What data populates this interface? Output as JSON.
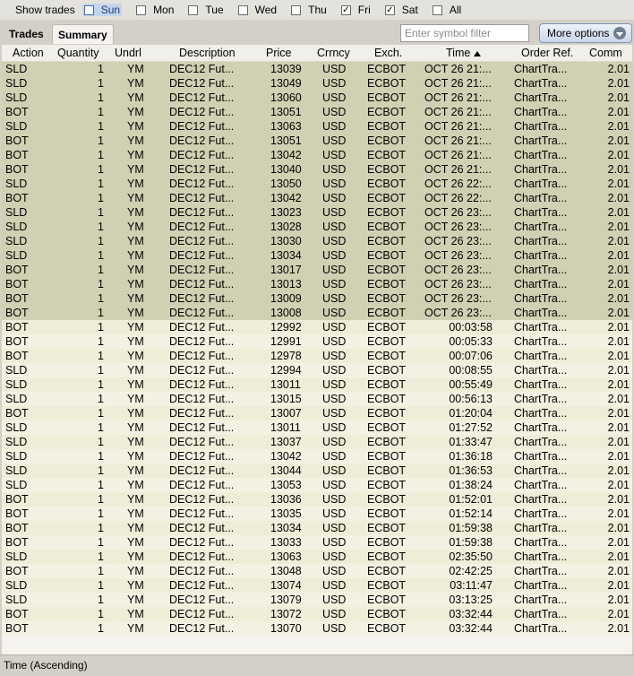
{
  "topbar": {
    "label": "Show trades",
    "days": [
      {
        "label": "Sun",
        "checked": false,
        "selected": true
      },
      {
        "label": "Mon",
        "checked": false
      },
      {
        "label": "Tue",
        "checked": false
      },
      {
        "label": "Wed",
        "checked": false
      },
      {
        "label": "Thu",
        "checked": false
      },
      {
        "label": "Fri",
        "checked": true
      },
      {
        "label": "Sat",
        "checked": true
      },
      {
        "label": "All",
        "checked": false
      }
    ]
  },
  "tabs": {
    "trades": "Trades",
    "summary": "Summary"
  },
  "filter": {
    "placeholder": "Enter symbol filter",
    "value": ""
  },
  "more_options": {
    "label": "More options",
    "icon": "chevron-down-icon"
  },
  "columns": [
    "Action",
    "Quantity",
    "Undrlyng",
    "Description",
    "Price",
    "Crrncy",
    "Exch.",
    "Time",
    "Order Ref.",
    "Comm"
  ],
  "sort": {
    "column": "Time",
    "direction": "ascending"
  },
  "rows": [
    [
      "SLD",
      "1",
      "YM",
      "DEC12 Fut...",
      "13039",
      "USD",
      "ECBOT",
      "OCT 26 21:...",
      "ChartTra...",
      "2.01"
    ],
    [
      "SLD",
      "1",
      "YM",
      "DEC12 Fut...",
      "13049",
      "USD",
      "ECBOT",
      "OCT 26 21:...",
      "ChartTra...",
      "2.01"
    ],
    [
      "SLD",
      "1",
      "YM",
      "DEC12 Fut...",
      "13060",
      "USD",
      "ECBOT",
      "OCT 26 21:...",
      "ChartTra...",
      "2.01"
    ],
    [
      "BOT",
      "1",
      "YM",
      "DEC12 Fut...",
      "13051",
      "USD",
      "ECBOT",
      "OCT 26 21:...",
      "ChartTra...",
      "2.01"
    ],
    [
      "SLD",
      "1",
      "YM",
      "DEC12 Fut...",
      "13063",
      "USD",
      "ECBOT",
      "OCT 26 21:...",
      "ChartTra...",
      "2.01"
    ],
    [
      "BOT",
      "1",
      "YM",
      "DEC12 Fut...",
      "13051",
      "USD",
      "ECBOT",
      "OCT 26 21:...",
      "ChartTra...",
      "2.01"
    ],
    [
      "BOT",
      "1",
      "YM",
      "DEC12 Fut...",
      "13042",
      "USD",
      "ECBOT",
      "OCT 26 21:...",
      "ChartTra...",
      "2.01"
    ],
    [
      "BOT",
      "1",
      "YM",
      "DEC12 Fut...",
      "13040",
      "USD",
      "ECBOT",
      "OCT 26 21:...",
      "ChartTra...",
      "2.01"
    ],
    [
      "SLD",
      "1",
      "YM",
      "DEC12 Fut...",
      "13050",
      "USD",
      "ECBOT",
      "OCT 26 22:...",
      "ChartTra...",
      "2.01"
    ],
    [
      "BOT",
      "1",
      "YM",
      "DEC12 Fut...",
      "13042",
      "USD",
      "ECBOT",
      "OCT 26 22:...",
      "ChartTra...",
      "2.01"
    ],
    [
      "SLD",
      "1",
      "YM",
      "DEC12 Fut...",
      "13023",
      "USD",
      "ECBOT",
      "OCT 26 23:...",
      "ChartTra...",
      "2.01"
    ],
    [
      "SLD",
      "1",
      "YM",
      "DEC12 Fut...",
      "13028",
      "USD",
      "ECBOT",
      "OCT 26 23:...",
      "ChartTra...",
      "2.01"
    ],
    [
      "SLD",
      "1",
      "YM",
      "DEC12 Fut...",
      "13030",
      "USD",
      "ECBOT",
      "OCT 26 23:...",
      "ChartTra...",
      "2.01"
    ],
    [
      "SLD",
      "1",
      "YM",
      "DEC12 Fut...",
      "13034",
      "USD",
      "ECBOT",
      "OCT 26 23:...",
      "ChartTra...",
      "2.01"
    ],
    [
      "BOT",
      "1",
      "YM",
      "DEC12 Fut...",
      "13017",
      "USD",
      "ECBOT",
      "OCT 26 23:...",
      "ChartTra...",
      "2.01"
    ],
    [
      "BOT",
      "1",
      "YM",
      "DEC12 Fut...",
      "13013",
      "USD",
      "ECBOT",
      "OCT 26 23:...",
      "ChartTra...",
      "2.01"
    ],
    [
      "BOT",
      "1",
      "YM",
      "DEC12 Fut...",
      "13009",
      "USD",
      "ECBOT",
      "OCT 26 23:...",
      "ChartTra...",
      "2.01"
    ],
    [
      "BOT",
      "1",
      "YM",
      "DEC12 Fut...",
      "13008",
      "USD",
      "ECBOT",
      "OCT 26 23:...",
      "ChartTra...",
      "2.01"
    ],
    [
      "BOT",
      "1",
      "YM",
      "DEC12 Fut...",
      "12992",
      "USD",
      "ECBOT",
      "00:03:58",
      "ChartTra...",
      "2.01"
    ],
    [
      "BOT",
      "1",
      "YM",
      "DEC12 Fut...",
      "12991",
      "USD",
      "ECBOT",
      "00:05:33",
      "ChartTra...",
      "2.01"
    ],
    [
      "BOT",
      "1",
      "YM",
      "DEC12 Fut...",
      "12978",
      "USD",
      "ECBOT",
      "00:07:06",
      "ChartTra...",
      "2.01"
    ],
    [
      "SLD",
      "1",
      "YM",
      "DEC12 Fut...",
      "12994",
      "USD",
      "ECBOT",
      "00:08:55",
      "ChartTra...",
      "2.01"
    ],
    [
      "SLD",
      "1",
      "YM",
      "DEC12 Fut...",
      "13011",
      "USD",
      "ECBOT",
      "00:55:49",
      "ChartTra...",
      "2.01"
    ],
    [
      "SLD",
      "1",
      "YM",
      "DEC12 Fut...",
      "13015",
      "USD",
      "ECBOT",
      "00:56:13",
      "ChartTra...",
      "2.01"
    ],
    [
      "BOT",
      "1",
      "YM",
      "DEC12 Fut...",
      "13007",
      "USD",
      "ECBOT",
      "01:20:04",
      "ChartTra...",
      "2.01"
    ],
    [
      "SLD",
      "1",
      "YM",
      "DEC12 Fut...",
      "13011",
      "USD",
      "ECBOT",
      "01:27:52",
      "ChartTra...",
      "2.01"
    ],
    [
      "SLD",
      "1",
      "YM",
      "DEC12 Fut...",
      "13037",
      "USD",
      "ECBOT",
      "01:33:47",
      "ChartTra...",
      "2.01"
    ],
    [
      "SLD",
      "1",
      "YM",
      "DEC12 Fut...",
      "13042",
      "USD",
      "ECBOT",
      "01:36:18",
      "ChartTra...",
      "2.01"
    ],
    [
      "SLD",
      "1",
      "YM",
      "DEC12 Fut...",
      "13044",
      "USD",
      "ECBOT",
      "01:36:53",
      "ChartTra...",
      "2.01"
    ],
    [
      "SLD",
      "1",
      "YM",
      "DEC12 Fut...",
      "13053",
      "USD",
      "ECBOT",
      "01:38:24",
      "ChartTra...",
      "2.01"
    ],
    [
      "BOT",
      "1",
      "YM",
      "DEC12 Fut...",
      "13036",
      "USD",
      "ECBOT",
      "01:52:01",
      "ChartTra...",
      "2.01"
    ],
    [
      "BOT",
      "1",
      "YM",
      "DEC12 Fut...",
      "13035",
      "USD",
      "ECBOT",
      "01:52:14",
      "ChartTra...",
      "2.01"
    ],
    [
      "BOT",
      "1",
      "YM",
      "DEC12 Fut...",
      "13034",
      "USD",
      "ECBOT",
      "01:59:38",
      "ChartTra...",
      "2.01"
    ],
    [
      "BOT",
      "1",
      "YM",
      "DEC12 Fut...",
      "13033",
      "USD",
      "ECBOT",
      "01:59:38",
      "ChartTra...",
      "2.01"
    ],
    [
      "SLD",
      "1",
      "YM",
      "DEC12 Fut...",
      "13063",
      "USD",
      "ECBOT",
      "02:35:50",
      "ChartTra...",
      "2.01"
    ],
    [
      "BOT",
      "1",
      "YM",
      "DEC12 Fut...",
      "13048",
      "USD",
      "ECBOT",
      "02:42:25",
      "ChartTra...",
      "2.01"
    ],
    [
      "SLD",
      "1",
      "YM",
      "DEC12 Fut...",
      "13074",
      "USD",
      "ECBOT",
      "03:11:47",
      "ChartTra...",
      "2.01"
    ],
    [
      "SLD",
      "1",
      "YM",
      "DEC12 Fut...",
      "13079",
      "USD",
      "ECBOT",
      "03:13:25",
      "ChartTra...",
      "2.01"
    ],
    [
      "BOT",
      "1",
      "YM",
      "DEC12 Fut...",
      "13072",
      "USD",
      "ECBOT",
      "03:32:44",
      "ChartTra...",
      "2.01"
    ],
    [
      "BOT",
      "1",
      "YM",
      "DEC12 Fut...",
      "13070",
      "USD",
      "ECBOT",
      "03:32:44",
      "ChartTra...",
      "2.01"
    ]
  ],
  "status": "Time (Ascending)",
  "colors": {
    "older_rows": "#d2d0b3",
    "newer_rows": "#eeedd7",
    "selected_day": "#c4d4ea"
  }
}
